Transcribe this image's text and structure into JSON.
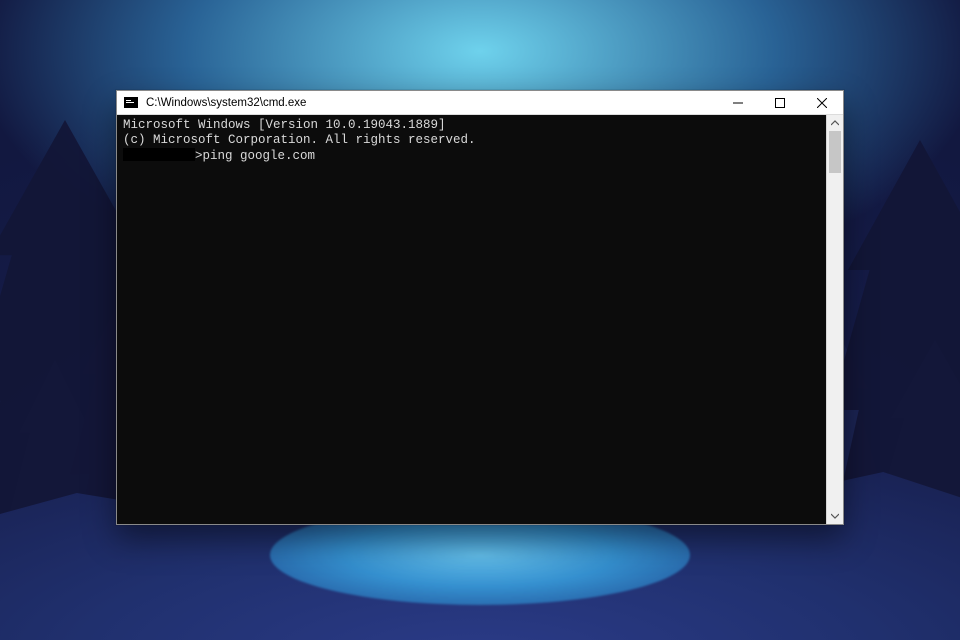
{
  "window": {
    "title": "C:\\Windows\\system32\\cmd.exe",
    "buttons": {
      "min": "Minimize",
      "max": "Maximize",
      "close": "Close"
    }
  },
  "terminal": {
    "line1": "Microsoft Windows [Version 10.0.19043.1889]",
    "line2": "(c) Microsoft Corporation. All rights reserved.",
    "blank": "",
    "prompt_suffix": ">",
    "command": "ping google.com"
  }
}
